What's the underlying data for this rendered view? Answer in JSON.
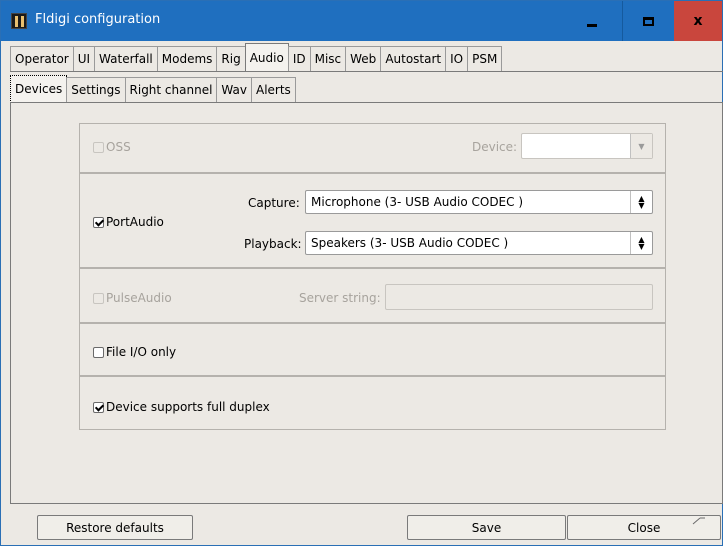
{
  "window": {
    "title": "Fldigi configuration",
    "close_glyph": "x"
  },
  "tabs_main": [
    "Operator",
    "UI",
    "Waterfall",
    "Modems",
    "Rig",
    "Audio",
    "ID",
    "Misc",
    "Web",
    "Autostart",
    "IO",
    "PSM"
  ],
  "tabs_main_active": "Audio",
  "tabs_sub": [
    "Devices",
    "Settings",
    "Right channel",
    "Wav",
    "Alerts"
  ],
  "tabs_sub_active": "Devices",
  "oss": {
    "label": "OSS",
    "checked": false,
    "enabled": false,
    "device_label": "Device:",
    "device_value": ""
  },
  "portaudio": {
    "label": "PortAudio",
    "checked": true,
    "capture_label": "Capture:",
    "capture_value": "Microphone (3- USB Audio CODEC )",
    "playback_label": "Playback:",
    "playback_value": "Speakers (3- USB Audio CODEC )"
  },
  "pulseaudio": {
    "label": "PulseAudio",
    "checked": false,
    "enabled": false,
    "server_label": "Server string:",
    "server_value": ""
  },
  "file_io": {
    "label": "File I/O only",
    "checked": false
  },
  "full_duplex": {
    "label": "Device supports full duplex",
    "checked": true
  },
  "buttons": {
    "restore": "Restore defaults",
    "save": "Save",
    "close": "Close"
  },
  "icons": {
    "app": "fldigi-app-icon",
    "minimize": "minimize-icon",
    "maximize": "maximize-icon",
    "close": "close-icon",
    "dropdown": "updown-arrow-icon"
  }
}
